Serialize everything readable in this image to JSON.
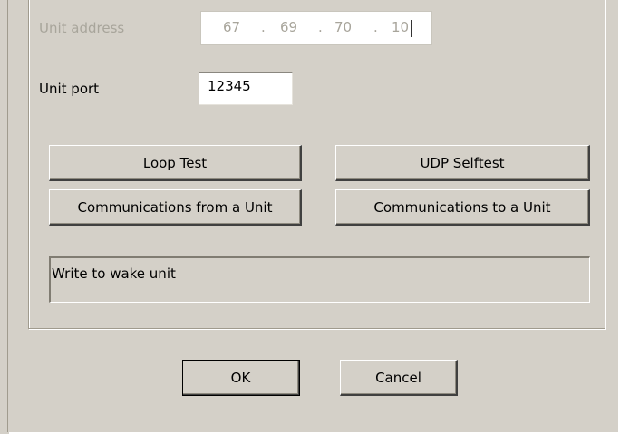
{
  "dialog": {
    "unit_address_label": "Unit address",
    "unit_address": {
      "octet1": "67",
      "octet2": "69",
      "octet3": "70",
      "octet4": "10",
      "separator": "."
    },
    "unit_port_label": "Unit port",
    "unit_port_value": "12345",
    "buttons": {
      "loop_test": "Loop Test",
      "udp_selftest": "UDP Selftest",
      "comms_from_unit": "Communications from a Unit",
      "comms_to_unit": "Communications to a Unit",
      "ok": "OK",
      "cancel": "Cancel"
    },
    "status_text": "Write to wake unit"
  }
}
